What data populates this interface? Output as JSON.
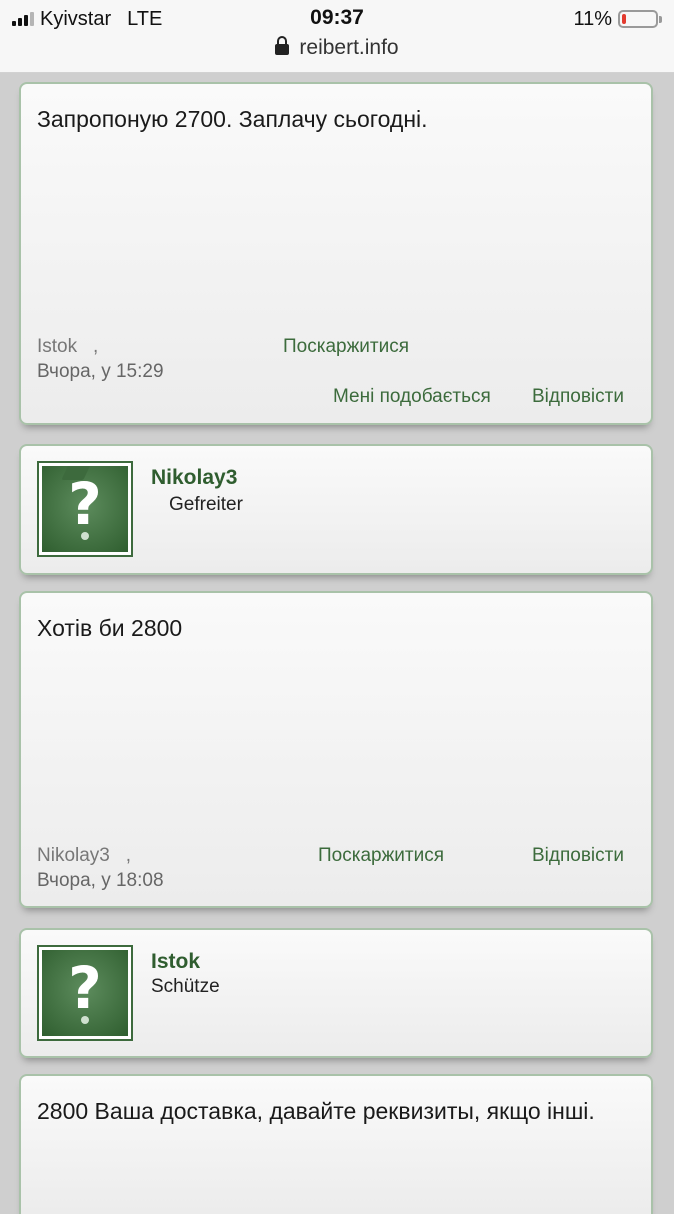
{
  "status_bar": {
    "carrier": "Kyivstar",
    "network": "LTE",
    "time": "09:37",
    "battery": "11%",
    "battery_level": 0.11,
    "battery_color": "#e33b2f",
    "url": "reibert.info"
  },
  "posts": [
    {
      "text": "Запропоную 2700. Заплачу сьогодні.",
      "author": "Istok",
      "separator": ",",
      "date": "Вчора, у 15:29",
      "report": "Поскаржитися",
      "like": "Мені подобається",
      "reply": "Відповісти"
    },
    {
      "text": "Хотів би 2800",
      "author": "Nikolay3",
      "separator": ",",
      "date": "Вчора, у 18:08",
      "report": "Поскаржитися",
      "reply": "Відповісти"
    },
    {
      "text": "2800 Ваша доставка, давайте реквизиты, якщо інші."
    }
  ],
  "users": [
    {
      "name": "Nikolay3",
      "rank": "Gefreiter",
      "avatar_icon": "question-mark-icon"
    },
    {
      "name": "Istok",
      "rank": "Schütze",
      "avatar_icon": "question-mark-icon"
    }
  ],
  "colors": {
    "accent": "#3c6b3c",
    "card_border": "#a9c2a9",
    "username": "#2f5d2f",
    "page_bg": "#cfcfcf"
  }
}
